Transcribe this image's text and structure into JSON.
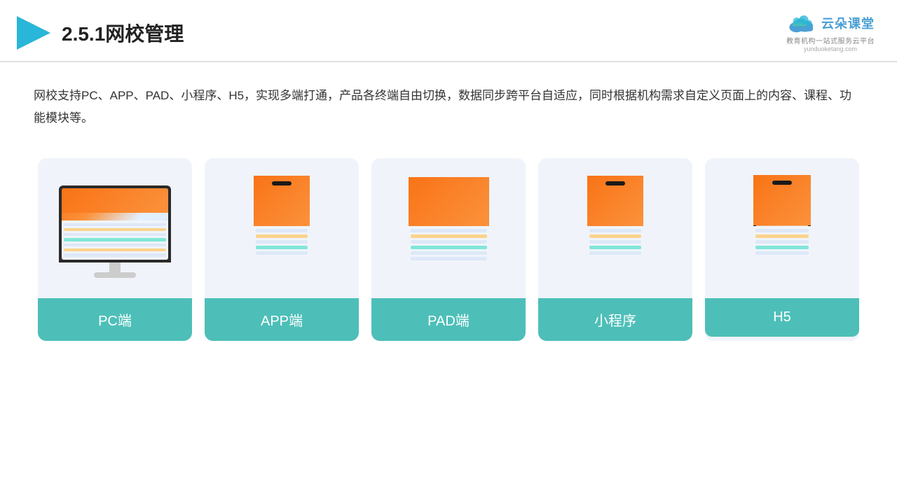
{
  "header": {
    "title": "2.5.1网校管理",
    "logo_text": "云朵课堂",
    "logo_sub": "教育机构一站\n式服务云平台",
    "logo_url": "yunduoketang.com"
  },
  "description": {
    "text": "网校支持PC、APP、PAD、小程序、H5，实现多端打通，产品各终端自由切换，数据同步跨平台自适应，同时根据机构需求自定义页面上的内容、课程、功能模块等。"
  },
  "cards": [
    {
      "id": "pc",
      "label": "PC端"
    },
    {
      "id": "app",
      "label": "APP端"
    },
    {
      "id": "pad",
      "label": "PAD端"
    },
    {
      "id": "miniprogram",
      "label": "小程序"
    },
    {
      "id": "h5",
      "label": "H5"
    }
  ],
  "colors": {
    "teal": "#4dbfb8",
    "accent_blue": "#4a9fd4",
    "bg_card": "#f0f4fa",
    "border_bottom": "#e0e0e0"
  }
}
